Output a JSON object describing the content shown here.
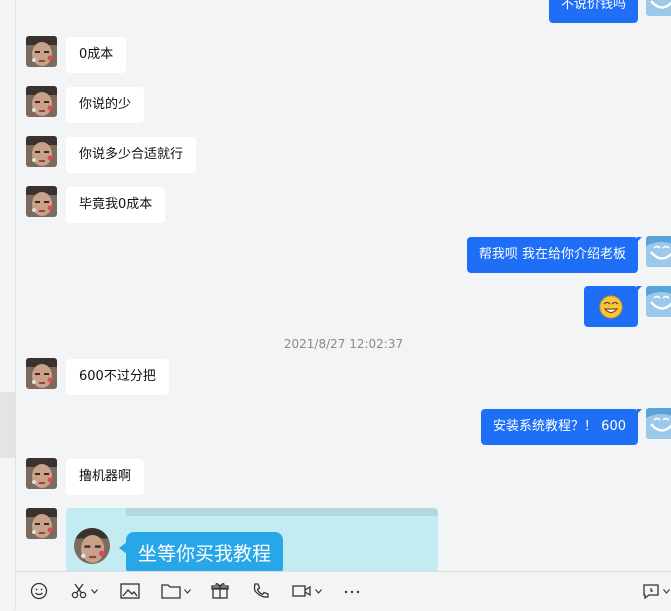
{
  "chat": {
    "timestamp": "2021/8/27 12:02:37",
    "messages": [
      {
        "side": "right",
        "text": "不说价钱吗"
      },
      {
        "side": "left",
        "text": "0成本"
      },
      {
        "side": "left",
        "text": "你说的少"
      },
      {
        "side": "left",
        "text": "你说多少合适就行"
      },
      {
        "side": "left",
        "text": "毕竟我0成本"
      },
      {
        "side": "right",
        "text": "帮我呗 我在给你介绍老板"
      },
      {
        "side": "right",
        "text": "",
        "emoji": "grinning-face-emoji"
      },
      {
        "side": "left",
        "text": "600不过分把"
      },
      {
        "side": "right",
        "text": "安装系统教程？！ 600"
      },
      {
        "side": "left",
        "text": "撸机器啊"
      },
      {
        "side": "left",
        "type": "image-card",
        "text": "坐等你买我教程"
      }
    ]
  },
  "toolbar": {
    "icons": [
      "emoji-icon",
      "scissors-icon",
      "image-icon",
      "folder-icon",
      "gift-icon",
      "phone-icon",
      "video-icon",
      "more-icon",
      "chat-history-icon"
    ]
  },
  "colors": {
    "outgoing_bubble": "#1e6ff6",
    "incoming_bubble": "#ffffff",
    "background": "#f3f4f6",
    "card_background": "#c3ecf2",
    "card_bubble": "#27a7e8"
  }
}
